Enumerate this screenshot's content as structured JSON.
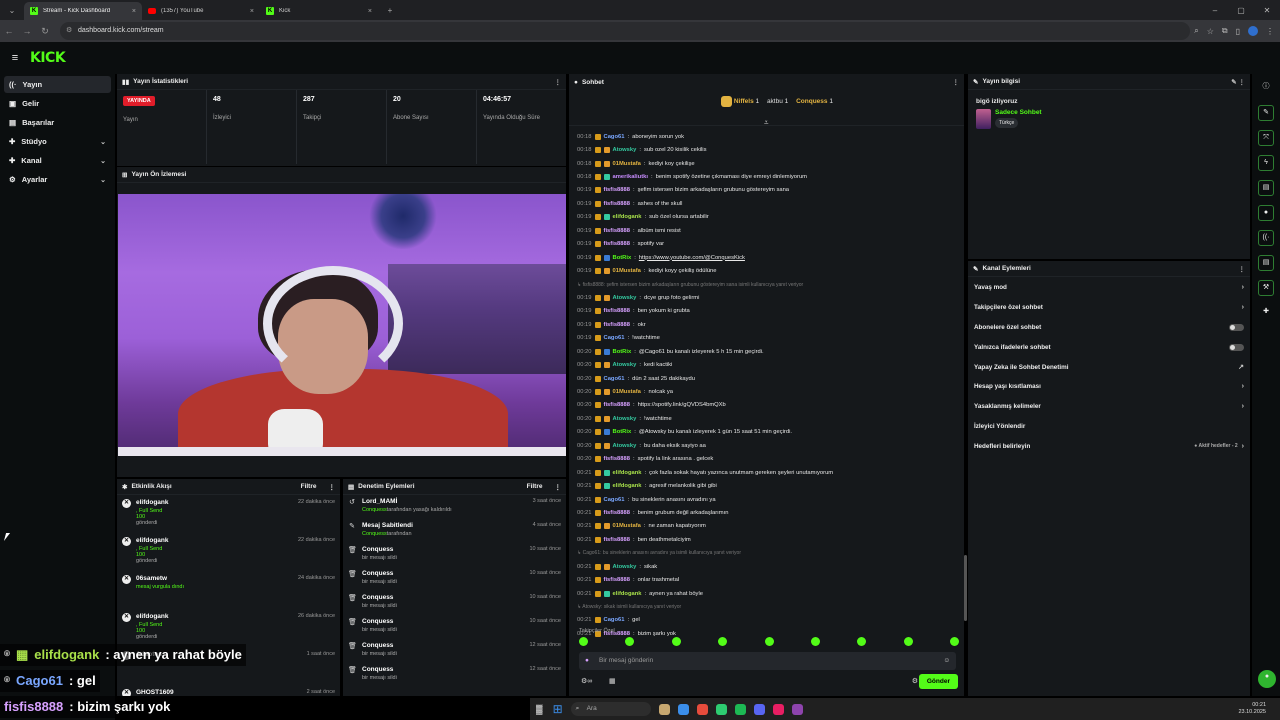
{
  "browser": {
    "tabs": [
      {
        "label": "Stream - Kick Dashboard",
        "active": true,
        "icon": "kick-icon"
      },
      {
        "label": "(1357) YouTube",
        "active": false,
        "icon": "youtube-icon"
      },
      {
        "label": "Kick",
        "active": false,
        "icon": "kick-icon"
      }
    ],
    "url": "dashboard.kick.com/stream"
  },
  "header": {
    "logo": "KICK"
  },
  "sidebar": {
    "items": [
      {
        "label": "Yayın",
        "icon": "signal-icon",
        "active": true
      },
      {
        "label": "Gelir",
        "icon": "wallet-icon"
      },
      {
        "label": "Başarılar",
        "icon": "trophy-icon"
      },
      {
        "label": "Stüdyo",
        "icon": "studio-icon",
        "expand": "⌄"
      },
      {
        "label": "Kanal",
        "icon": "channel-icon",
        "expand": "⌄"
      },
      {
        "label": "Ayarlar",
        "icon": "gear-icon",
        "expand": "⌄"
      }
    ]
  },
  "stats_panel": {
    "title": "Yayın İstatistikleri",
    "live_badge": "YAYINDA",
    "items": [
      {
        "value": "",
        "label": "Yayın"
      },
      {
        "value": "48",
        "label": "İzleyici"
      },
      {
        "value": "287",
        "label": "Takipçi"
      },
      {
        "value": "20",
        "label": "Abone Sayısı"
      },
      {
        "value": "04:46:57",
        "label": "Yayında Olduğu Süre"
      }
    ]
  },
  "preview_panel": {
    "title": "Yayın Ön İzlemesi"
  },
  "activity_panel": {
    "title": "Etkinlik Akışı",
    "filter": "Filtre",
    "items": [
      {
        "user": "elifdogank",
        "line1": ", Full Send",
        "line2": "100",
        "line3": "gönderdi",
        "time": "22 dakika önce"
      },
      {
        "user": "elifdogank",
        "line1": ", Full Send",
        "line2": "100",
        "line3": "gönderdi",
        "time": "22 dakika önce"
      },
      {
        "user": "06sametw",
        "line1": "mesaj vurgula dındı",
        "line2": "",
        "line3": "",
        "time": "24 dakika önce"
      },
      {
        "user": "elifdogank",
        "line1": ", Full Send",
        "line2": "100",
        "line3": "gönderdi",
        "time": "26 dakika önce"
      },
      {
        "user": "Adaptos",
        "line1": "",
        "line2": "",
        "line3": "",
        "time": "1 saat önce"
      },
      {
        "user": "GHOST1609",
        "line1": ", Full Send",
        "line2": "",
        "line3": "",
        "time": "2 saat önce"
      }
    ]
  },
  "moderation_panel": {
    "title": "Denetim Eylemleri",
    "filter": "Filtre",
    "items": [
      {
        "title": "Lord_MAMİ",
        "sub_user": "Conquess",
        "sub": "tarafından yasağı kaldırıldı",
        "time": "3 saat önce",
        "icon": "undo-icon"
      },
      {
        "title": "Mesaj Sabitlendi",
        "sub_user": "Conquess",
        "sub": "tarafından",
        "time": "4 saat önce",
        "icon": "pin-icon"
      },
      {
        "title": "Conquess",
        "sub_user": "",
        "sub": "bir mesajı sildi",
        "time": "10 saat önce",
        "icon": "trash-icon"
      },
      {
        "title": "Conquess",
        "sub_user": "",
        "sub": "bir mesajı sildi",
        "time": "10 saat önce",
        "icon": "trash-icon"
      },
      {
        "title": "Conquess",
        "sub_user": "",
        "sub": "bir mesajı sildi",
        "time": "10 saat önce",
        "icon": "trash-icon"
      },
      {
        "title": "Conquess",
        "sub_user": "",
        "sub": "bir mesajı sildi",
        "time": "10 saat önce",
        "icon": "trash-icon"
      },
      {
        "title": "Conquess",
        "sub_user": "",
        "sub": "bir mesajı sildi",
        "time": "12 saat önce",
        "icon": "trash-icon"
      },
      {
        "title": "Conquess",
        "sub_user": "",
        "sub": "bir mesajı sildi",
        "time": "12 saat önce",
        "icon": "trash-icon"
      }
    ]
  },
  "chat": {
    "title": "Sohbet",
    "pinned": {
      "u1": "Niffels",
      "c1": "1",
      "u2": "aktbu",
      "c2": "1",
      "u3": "Conquess",
      "c3": "1"
    },
    "messages": [
      {
        "t": "00:18",
        "u": "Cago61",
        "c": "#7aa7ff",
        "x": "aboneyim sorun yok",
        "b": ""
      },
      {
        "t": "00:18",
        "u": "Atowsky",
        "c": "#34c9a0",
        "x": "sub ozel 20 kisilik cekilis",
        "b": "o"
      },
      {
        "t": "00:18",
        "u": "01Mustafa",
        "c": "#e3b341",
        "x": "kediyi koy çekilişe",
        "b": "o"
      },
      {
        "t": "00:18",
        "u": "amerikaliutkı",
        "c": "#c88cff",
        "x": "benim spotify özetine çıkmaması diye emreyi dinlemiyorum",
        "b": "g"
      },
      {
        "t": "00:19",
        "u": "fisfis8888",
        "c": "#d7a1ff",
        "x": "şefim istersen bizim arkadaşların grubunu göstereyim sana",
        "b": ""
      },
      {
        "t": "00:19",
        "u": "fisfis8888",
        "c": "#d7a1ff",
        "x": "ashes of the skull",
        "b": ""
      },
      {
        "t": "00:19",
        "u": "elifdogank",
        "c": "#a8e04a",
        "x": "sub özel olursa artabilir",
        "b": "g"
      },
      {
        "t": "00:19",
        "u": "fisfis8888",
        "c": "#d7a1ff",
        "x": "albüm ismi resist",
        "b": ""
      },
      {
        "t": "00:19",
        "u": "fisfis8888",
        "c": "#d7a1ff",
        "x": "spotify var",
        "b": ""
      },
      {
        "t": "00:19",
        "u": "BotRix",
        "c": "#53fc18",
        "x": "https://www.youtube.com/@ConquesKick",
        "b": "b"
      },
      {
        "t": "00:19",
        "u": "01Mustafa",
        "c": "#e3b341",
        "x": "kediyi koyy çekiliş ödülüne",
        "b": "o"
      },
      {
        "t": "",
        "u": "",
        "c": "#777",
        "x": "↳ fisfis8888: şefim istersen bizim arkadaşların grubunu göstereyim sana isimli kullanıcıya yanıt veriyor",
        "b": "r"
      },
      {
        "t": "00:19",
        "u": "Atowsky",
        "c": "#34c9a0",
        "x": "dcye grup foto gelirmi",
        "b": "o"
      },
      {
        "t": "00:19",
        "u": "fisfis8888",
        "c": "#d7a1ff",
        "x": "ben yokum ki grubta",
        "b": ""
      },
      {
        "t": "00:19",
        "u": "fisfis8888",
        "c": "#d7a1ff",
        "x": "okr",
        "b": ""
      },
      {
        "t": "00:19",
        "u": "Cago61",
        "c": "#7aa7ff",
        "x": "!watchtime",
        "b": ""
      },
      {
        "t": "00:20",
        "u": "BotRix",
        "c": "#53fc18",
        "x": "@Cago61 bu kanalı izleyerek 5 h 15 min geçirdi.",
        "b": "b"
      },
      {
        "t": "00:20",
        "u": "Atowsky",
        "c": "#34c9a0",
        "x": "kedi kactiki",
        "b": "o"
      },
      {
        "t": "00:20",
        "u": "Cago61",
        "c": "#7aa7ff",
        "x": "dün 2 saat 25 dakikaydu",
        "b": ""
      },
      {
        "t": "00:20",
        "u": "01Mustafa",
        "c": "#e3b341",
        "x": "nolcak ya",
        "b": "o"
      },
      {
        "t": "00:20",
        "u": "fisfis8888",
        "c": "#d7a1ff",
        "x": "https://spotify.link/gQVDS4bmQXb",
        "b": ""
      },
      {
        "t": "00:20",
        "u": "Atowsky",
        "c": "#34c9a0",
        "x": "!watchtime",
        "b": "o"
      },
      {
        "t": "00:20",
        "u": "BotRix",
        "c": "#53fc18",
        "x": "@Atowsky bu kanalı izleyerek 1 gün 15 saat 51 min geçirdi.",
        "b": "b"
      },
      {
        "t": "00:20",
        "u": "Atowsky",
        "c": "#34c9a0",
        "x": "bu daha eksik sayiyo aa",
        "b": "o"
      },
      {
        "t": "00:20",
        "u": "fisfis8888",
        "c": "#d7a1ff",
        "x": "spotify la link arasına . gelcek",
        "b": ""
      },
      {
        "t": "00:21",
        "u": "elifdogank",
        "c": "#a8e04a",
        "x": "çok fazla sokak hayatı yazınca unutmam gereken şeyleri unutamıyorum",
        "b": "g"
      },
      {
        "t": "00:21",
        "u": "elifdogank",
        "c": "#a8e04a",
        "x": "agresif melankolik gibi gibi",
        "b": "g"
      },
      {
        "t": "00:21",
        "u": "Cago61",
        "c": "#7aa7ff",
        "x": "bu sineklerin anasını avradını ya",
        "b": ""
      },
      {
        "t": "00:21",
        "u": "fisfis8888",
        "c": "#d7a1ff",
        "x": "benim grubum değil arkadaşlarımın",
        "b": ""
      },
      {
        "t": "00:21",
        "u": "01Mustafa",
        "c": "#e3b341",
        "x": "ne zaman kapatıyorım",
        "b": "o"
      },
      {
        "t": "00:21",
        "u": "fisfis8888",
        "c": "#d7a1ff",
        "x": "ben deathmetalciyim",
        "b": ""
      },
      {
        "t": "",
        "u": "",
        "c": "#777",
        "x": "↳ Cago61: bu sineklerin anasını avradını ya isimli kullanıcıya yanıt veriyor",
        "b": "r"
      },
      {
        "t": "00:21",
        "u": "Atowsky",
        "c": "#34c9a0",
        "x": "sikak",
        "b": "o"
      },
      {
        "t": "00:21",
        "u": "fisfis8888",
        "c": "#d7a1ff",
        "x": "onlar trashmetal",
        "b": ""
      },
      {
        "t": "00:21",
        "u": "elifdogank",
        "c": "#a8e04a",
        "x": "aynen ya rahat böyle",
        "b": "g"
      },
      {
        "t": "",
        "u": "",
        "c": "#777",
        "x": "↳ Atowsky: sikak isimli kullanıcıya yanıt veriyor",
        "b": "r"
      },
      {
        "t": "00:21",
        "u": "Cago61",
        "c": "#7aa7ff",
        "x": "gel",
        "b": ""
      },
      {
        "t": "00:21",
        "u": "fisfis8888",
        "c": "#d7a1ff",
        "x": "bizim şarkı yok",
        "b": ""
      }
    ],
    "followers_only": "Takipçiler Özel",
    "input_placeholder": "Bir mesaj gönderin",
    "send": "Gönder"
  },
  "stream_info": {
    "title": "Yayın bilgisi",
    "stream_title": "bigö izliyoruz",
    "category": "Sadece Sohbet",
    "language": "Türkçe"
  },
  "channel_actions": {
    "title": "Kanal Eylemleri",
    "items": [
      {
        "label": "Yavaş mod",
        "ctrl": "arrow"
      },
      {
        "label": "Takipçilere özel sohbet",
        "ctrl": "arrow"
      },
      {
        "label": "Abonelere özel sohbet",
        "ctrl": "toggle"
      },
      {
        "label": "Yalnızca ifadelerle sohbet",
        "ctrl": "toggle"
      },
      {
        "label": "Yapay Zeka ile Sohbet Denetimi",
        "ctrl": "ext"
      },
      {
        "label": "Hesap yaşı kısıtlaması",
        "ctrl": "arrow"
      },
      {
        "label": "Yasaklanmış kelimeler",
        "ctrl": "arrow"
      },
      {
        "label": "İzleyici Yönlendir",
        "ctrl": "none"
      },
      {
        "label": "Hedefleri belirleyin",
        "ctrl": "goals",
        "extra": "● Aktif hedefler - 2"
      }
    ]
  },
  "overlay": [
    {
      "user": "elifdogank",
      "text": ": aynen ya rahat böyle"
    },
    {
      "user": "Cago61",
      "text": ": gel"
    },
    {
      "user": "fisfis8888",
      "text": ": bizim şarkı yok"
    }
  ],
  "taskbar": {
    "search": "Ara",
    "time": "00:21",
    "date": "23.10.2025"
  },
  "colors": {
    "accent": "#53fc18",
    "live": "#e11d2a",
    "panel": "#15181b"
  }
}
